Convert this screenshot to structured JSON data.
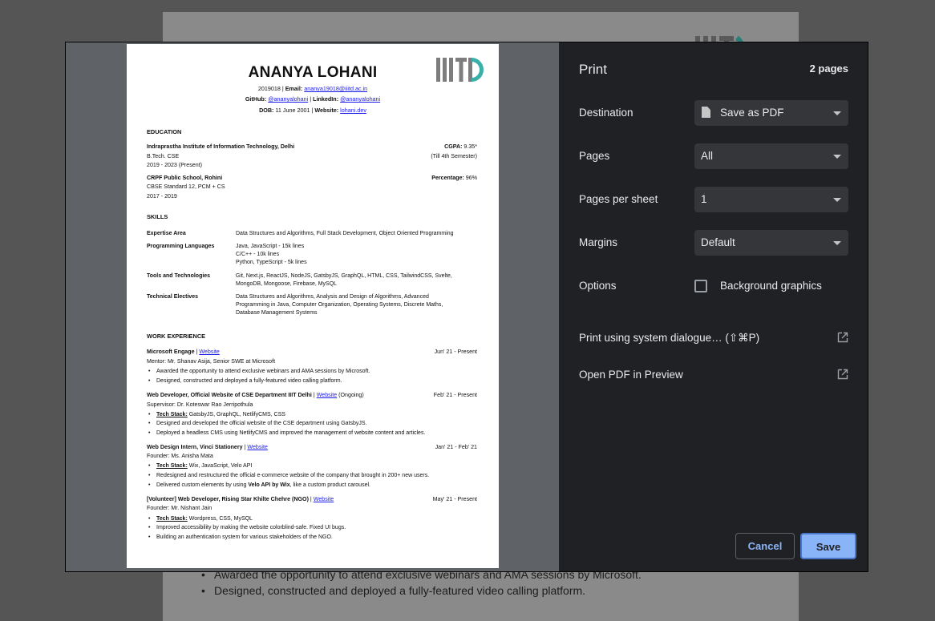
{
  "background_doc": {
    "bullets": [
      "Awarded the opportunity to attend exclusive webinars and AMA sessions by Microsoft.",
      "Designed, constructed and deployed a fully-featured video calling platform."
    ]
  },
  "preview": {
    "name": "ANANYA LOHANI",
    "line1_pre": "2019018 | ",
    "line1_label": "Email:",
    "line1_link": "ananya19018@iiitd.ac.in",
    "line2_label1": "GitHub:",
    "line2_link1": "@ananyalohani",
    "line2_sep": " | ",
    "line2_label2": "LinkedIn:",
    "line2_link2": "@ananyalohani",
    "line3_label1": "DOB:",
    "line3_val1": " 11 June 2001 | ",
    "line3_label2": "Website:",
    "line3_link": "lohani.dev",
    "education_title": "EDUCATION",
    "education": [
      {
        "school": "Indraprastha Institute of Information Technology, Delhi",
        "right_label": "CGPA:",
        "right_val": " 9.35*",
        "line2": "B.Tech. CSE",
        "line2_right": "(Till 4th Semester)",
        "line3": "2019 - 2023 (Present)"
      },
      {
        "school": "CRPF Public School, Rohini",
        "right_label": "Percentage:",
        "right_val": " 96%",
        "line2": "CBSE Standard 12, PCM + CS",
        "line2_right": "",
        "line3": "2017 - 2019"
      }
    ],
    "skills_title": "SKILLS",
    "skills": [
      {
        "key": "Expertise Area",
        "lines": [
          "Data Structures and Algorithms, Full Stack Development, Object Oriented Programming"
        ]
      },
      {
        "key": "Programming Languages",
        "lines": [
          "Java, JavaScript - 15k lines",
          "C/C++ - 10k lines",
          "Python, TypeScript - 5k lines"
        ]
      },
      {
        "key": "Tools and Technologies",
        "lines": [
          "Git, Next.js, ReactJS, NodeJS, GatsbyJS, GraphQL, HTML, CSS, TailwindCSS, Svelte,",
          "MongoDB, Mongoose, Firebase, MySQL"
        ]
      },
      {
        "key": "Technical Electives",
        "lines": [
          "Data Structures and Algorithms, Analysis and Design of Algorithms, Advanced",
          "Programming in Java, Computer Organization, Operating Systems, Discrete Maths,",
          "Database Management Systems"
        ]
      }
    ],
    "work_title": "WORK EXPERIENCE",
    "jobs": [
      {
        "title": "Microsoft Engage",
        "sep": " | ",
        "link": "Website",
        "suffix": "",
        "date": "Jun' 21 - Present",
        "sub": "Mentor: Mr. Shanav Asija, Senior SWE at Microsoft",
        "bullets": [
          {
            "pre": "",
            "strong": "",
            "text": "Awarded the opportunity to attend exclusive webinars and AMA sessions by Microsoft."
          },
          {
            "pre": "",
            "strong": "",
            "text": "Designed, constructed and deployed a fully-featured video calling platform."
          }
        ]
      },
      {
        "title": "Web Developer, Official Website of CSE Department IIIT Delhi",
        "sep": " | ",
        "link": "Website",
        "suffix": " (Ongoing)",
        "date": "Feb' 21 - Present",
        "sub": "Supervisor: Dr. Koteswar Rao Jerripothula",
        "bullets": [
          {
            "pre": "Tech Stack:",
            "strong": "",
            "text": " GatsbyJS, GraphQL, NetlifyCMS, CSS"
          },
          {
            "pre": "",
            "strong": "",
            "text": "Designed and developed the official website of the CSE department using GatsbyJS."
          },
          {
            "pre": "",
            "strong": "",
            "text": "Deployed a headless CMS using NetlifyCMS and improved the management of website content and articles."
          }
        ]
      },
      {
        "title": "Web Design Intern, Vinci Stationery",
        "sep": " | ",
        "link": "Website",
        "suffix": "",
        "date": "Jan' 21 - Feb' 21",
        "sub": "Founder: Ms. Anisha Mata",
        "bullets": [
          {
            "pre": "Tech Stack:",
            "strong": "",
            "text": " Wix, JavaScript, Velo API"
          },
          {
            "pre": "",
            "strong": "",
            "text": "Redesigned and restructured the official e-commerce website of the company that brought in 200+ new users."
          },
          {
            "pre": "",
            "text": "Delivered custom elements by using ",
            "strong": "Velo API by Wix",
            "after": ", like a custom product carousel."
          }
        ]
      },
      {
        "title": "[Volunteer] Web Developer, Rising Star Khilte Chehre (NGO)",
        "sep": " | ",
        "link": "Website",
        "suffix": "",
        "date": "May' 21 - Present",
        "sub": "Founder: Mr. Nishant Jain",
        "bullets": [
          {
            "pre": "Tech Stack:",
            "strong": "",
            "text": " Wordpress, CSS, MySQL"
          },
          {
            "pre": "",
            "strong": "",
            "text": "Improved accessibility by making the website colorblind-safe. Fixed UI bugs."
          },
          {
            "pre": "",
            "strong": "",
            "text": "Building an authentication system for various stakeholders of the NGO."
          }
        ]
      }
    ]
  },
  "print": {
    "title": "Print",
    "page_count": "2 pages",
    "destination_label": "Destination",
    "destination_value": "Save as PDF",
    "pages_label": "Pages",
    "pages_value": "All",
    "pps_label": "Pages per sheet",
    "pps_value": "1",
    "margins_label": "Margins",
    "margins_value": "Default",
    "options_label": "Options",
    "background_graphics_label": "Background graphics",
    "background_graphics_checked": false,
    "system_dialog_label": "Print using system dialogue… (⇧⌘P)",
    "open_pdf_label": "Open PDF in Preview",
    "cancel_label": "Cancel",
    "save_label": "Save"
  },
  "colors": {
    "panel_bg": "#202124",
    "select_bg": "#35363a",
    "accent": "#8ab4f8",
    "iiitd_teal": "#3bb0a8"
  },
  "icons": [
    "iiitd-logo",
    "document-icon",
    "chevron-down-icon",
    "checkbox",
    "open-external-icon"
  ]
}
